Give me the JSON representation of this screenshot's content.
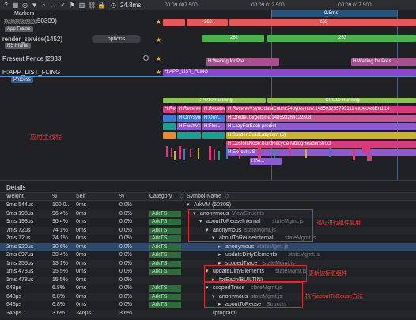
{
  "toolbar": {
    "zoom": "24.8ms",
    "ticks": [
      "00:09.007.500",
      "00:09.012.500",
      "00:09.017.500"
    ],
    "markers": "Markers"
  },
  "range": {
    "label": "9.5ms"
  },
  "tracks": {
    "thread_id": "50309)",
    "app_frame_tag": "App Frame",
    "render_service": "render_service(1452)",
    "options_label": "options",
    "rs_frame_tag": "RS Frame",
    "present_fence": "Present Fence [2833]",
    "app_list_fling": "H:APP_LIST_FLING",
    "process_tag": "Process"
  },
  "frames": {
    "a1": "262",
    "a2": "263",
    "r1": "262",
    "r2": "263",
    "pf1": "H:Waiting for Pre...",
    "pf2": "H:Waiting for Pres...",
    "fling": "H:APP_LIST_FLING"
  },
  "main_slices": [
    {
      "row": 0,
      "items": [
        "CPU10 Running",
        "CPU10 Running"
      ]
    },
    {
      "row": 1,
      "items": [
        "H:ReceiveV...",
        "H:ReceiveV...",
        "H:ReceiveVsync dataCount:24bytes now:148593255799111 expectedEnd:14"
      ]
    },
    {
      "row": 2,
      "items": [
        "H:OnVsync",
        "H:OnV...",
        "H:OnV...",
        "H:OnIdle, targettime:148593264122808"
      ]
    },
    {
      "row": 3,
      "items": [
        "H:FlushVs...",
        "H:Flus...",
        "H:LazyForEach predict"
      ]
    },
    {
      "row": 4,
      "items": [
        "H:Builder:BuildLazyItem (5)"
      ]
    },
    {
      "row": 5,
      "items": [
        "H:CustomNode:BuildRecycle MblogHeaderStruct"
      ]
    },
    {
      "row": 6,
      "items": [
        "H:ExecuteJS"
      ]
    },
    {
      "row": 7,
      "items": [
        "H:Vi..."
      ]
    }
  ],
  "main_thread_note": "应用主线程",
  "details": {
    "title": "Details",
    "headers": [
      "Weight",
      "%",
      "Self",
      "%",
      "Category",
      "Symbol Name"
    ],
    "root": "ArkVM (50309)",
    "rows": [
      {
        "w": "9ms 544μs",
        "p": "100.0...",
        "s": "0ms",
        "sp": "0.0%",
        "cat": "",
        "indent": 0,
        "arrow": "▾",
        "sym": "ArkVM (50309)",
        "file": ""
      },
      {
        "w": "9ms 198μs",
        "p": "96.4%",
        "s": "0ms",
        "sp": "0.0%",
        "cat": "ArkTS",
        "indent": 1,
        "arrow": "▾",
        "sym": "anonymous",
        "file": "ViewStruct.ts"
      },
      {
        "w": "9ms 198μs",
        "p": "96.4%",
        "s": "0ms",
        "sp": "0.0%",
        "cat": "ArkTS",
        "indent": 2,
        "arrow": "▾",
        "sym": "aboutToReuseInternal",
        "file": "stateMgmt.js"
      },
      {
        "w": "7ms 72μs",
        "p": "74.1%",
        "s": "0ms",
        "sp": "0.0%",
        "cat": "ArkTS",
        "indent": 3,
        "arrow": "▾",
        "sym": "anonymous",
        "file": "stateMgmt.js"
      },
      {
        "w": "7ms 72μs",
        "p": "74.1%",
        "s": "0ms",
        "sp": "0.0%",
        "cat": "ArkTS",
        "indent": 4,
        "arrow": "▾",
        "sym": "aboutToReuseInternal",
        "file": "stateMgmt.js"
      },
      {
        "w": "2ms 920μs",
        "p": "30.6%",
        "s": "0ms",
        "sp": "0.0%",
        "cat": "ArkTS",
        "indent": 5,
        "arrow": "▸",
        "sym": "anonymous",
        "file": "stateMgmt.js"
      },
      {
        "w": "2ms 897μs",
        "p": "30.4%",
        "s": "0ms",
        "sp": "0.0%",
        "cat": "ArkTS",
        "indent": 5,
        "arrow": "▸",
        "sym": "updateDirtyElements",
        "file": "stateMgmt.js"
      },
      {
        "w": "1ms 255μs",
        "p": "13.1%",
        "s": "0ms",
        "sp": "0.0%",
        "cat": "ArkTS",
        "indent": 5,
        "arrow": "▸",
        "sym": "scopedTrace",
        "file": "stateMgmt.js"
      },
      {
        "w": "1ms 478μs",
        "p": "15.5%",
        "s": "0ms",
        "sp": "0.0%",
        "cat": "ArkTS",
        "indent": 3,
        "arrow": "▾",
        "sym": "updateDirtyElements",
        "file": "stateMgmt.js"
      },
      {
        "w": "1ms 478μs",
        "p": "15.5%",
        "s": "0ms",
        "sp": "0.0%",
        "cat": "",
        "indent": 4,
        "arrow": "▸",
        "sym": "forEach(BUILTIN)",
        "file": ""
      },
      {
        "w": "648μs",
        "p": "6.8%",
        "s": "0ms",
        "sp": "0.0%",
        "cat": "ArkTS",
        "indent": 3,
        "arrow": "▾",
        "sym": "scopedTrace",
        "file": "stateMgmt.js"
      },
      {
        "w": "648μs",
        "p": "6.8%",
        "s": "0ms",
        "sp": "0.0%",
        "cat": "ArkTS",
        "indent": 4,
        "arrow": "▾",
        "sym": "anonymous",
        "file": "stateMgmt.js"
      },
      {
        "w": "648μs",
        "p": "6.8%",
        "s": "0ms",
        "sp": "0.0%",
        "cat": "ArkTS",
        "indent": 5,
        "arrow": "▸",
        "sym": "aboutToReuse",
        "file": "Struct.ts"
      },
      {
        "w": "346μs",
        "p": "3.6%",
        "s": "346μs",
        "sp": "3.6%",
        "cat": "",
        "indent": 3,
        "arrow": "",
        "sym": "(program)",
        "file": ""
      }
    ],
    "annotations": [
      "递归进行组件复用",
      "更新被标脏组件",
      "执行aboutToReuse方法"
    ]
  },
  "colors": {
    "frame_red": "#e3585a",
    "frame_green": "#4caf50",
    "fling_purple": "#8c44c8",
    "cpu_green": "#8bc34a",
    "teal": "#1e9e93",
    "blue": "#3b78d8",
    "pink": "#d63c7b",
    "purple": "#8e5ad0",
    "orange": "#ef8a2a",
    "yellow": "#ccb22c",
    "annot": "#e0282a"
  }
}
